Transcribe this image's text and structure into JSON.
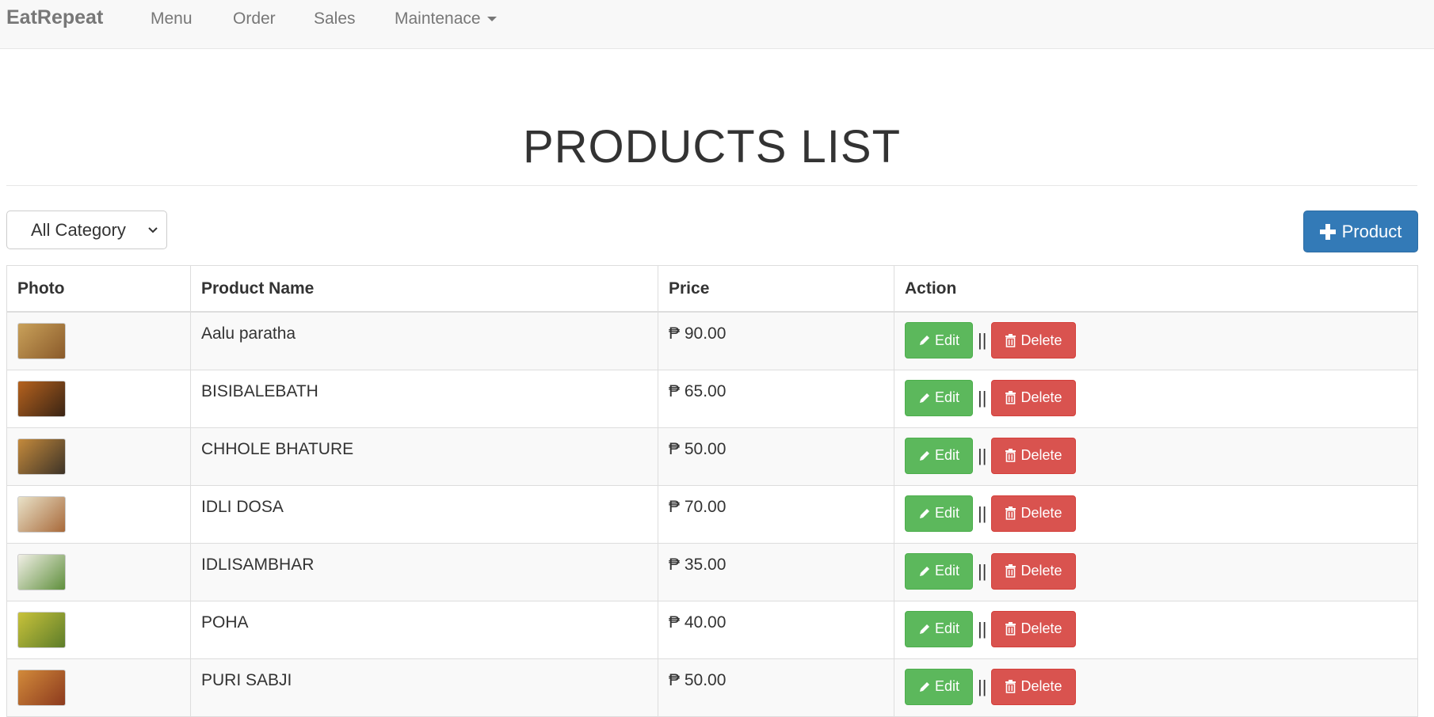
{
  "navbar": {
    "brand": "EatRepeat",
    "items": [
      "Menu",
      "Order",
      "Sales",
      "Maintenace"
    ]
  },
  "page_title": "PRODUCTS LIST",
  "category_filter": {
    "selected": "All Category"
  },
  "add_button": {
    "label": "Product",
    "icon": "plus-icon"
  },
  "table": {
    "headers": [
      "Photo",
      "Product Name",
      "Price",
      "Action"
    ],
    "rows": [
      {
        "name": "Aalu paratha",
        "price": "₱ 90.00",
        "thumb_colors": [
          "#c9a15a",
          "#8a5a2a"
        ]
      },
      {
        "name": "BISIBALEBATH",
        "price": "₱ 65.00",
        "thumb_colors": [
          "#b5621e",
          "#3a2414"
        ]
      },
      {
        "name": "CHHOLE BHATURE",
        "price": "₱ 50.00",
        "thumb_colors": [
          "#c48a3c",
          "#3d3327"
        ]
      },
      {
        "name": "IDLI DOSA",
        "price": "₱ 70.00",
        "thumb_colors": [
          "#e9e2c8",
          "#a8693a"
        ]
      },
      {
        "name": "IDLISAMBHAR",
        "price": "₱ 35.00",
        "thumb_colors": [
          "#f1efe6",
          "#5f8f3c"
        ]
      },
      {
        "name": "POHA",
        "price": "₱ 40.00",
        "thumb_colors": [
          "#c8c23a",
          "#5d7d2a"
        ]
      },
      {
        "name": "PURI SABJI",
        "price": "₱ 50.00",
        "thumb_colors": [
          "#d28a3a",
          "#8c3a1e"
        ]
      }
    ],
    "edit_label": "Edit",
    "delete_label": "Delete",
    "separator": "||"
  },
  "colors": {
    "primary": "#337ab7",
    "success": "#5cb85c",
    "danger": "#d9534f"
  }
}
